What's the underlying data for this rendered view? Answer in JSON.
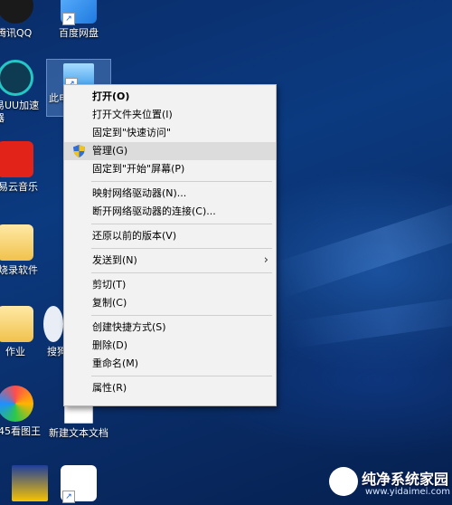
{
  "desktop": {
    "icons": [
      {
        "label": "腾讯QQ",
        "icon": "qq-icon"
      },
      {
        "label": "百度网盘",
        "icon": "baidu-netdisk-icon"
      },
      {
        "label": "易UU加速\n器",
        "icon": "uu-accelerator-icon"
      },
      {
        "label": "此电",
        "icon": "this-pc-icon"
      },
      {
        "label": "易云音乐",
        "icon": "netease-music-icon"
      },
      {
        "label": "烧录软件",
        "icon": "burn-software-folder-icon"
      },
      {
        "label": "作业",
        "icon": "homework-folder-icon"
      },
      {
        "label": "搜狗",
        "icon": "sogou-icon"
      },
      {
        "label": "45看图王",
        "icon": "image-viewer-icon"
      },
      {
        "label": "新建文本文档",
        "icon": "text-document-icon"
      }
    ]
  },
  "context_menu": {
    "items": [
      {
        "label": "打开(O)",
        "bold": true
      },
      {
        "label": "打开文件夹位置(I)"
      },
      {
        "label": "固定到\"快速访问\""
      },
      {
        "label": "管理(G)",
        "icon": "uac-shield-icon",
        "highlight": true
      },
      {
        "label": "固定到\"开始\"屏幕(P)"
      },
      {
        "sep": true
      },
      {
        "label": "映射网络驱动器(N)..."
      },
      {
        "label": "断开网络驱动器的连接(C)..."
      },
      {
        "sep": true
      },
      {
        "label": "还原以前的版本(V)"
      },
      {
        "sep": true
      },
      {
        "label": "发送到(N)",
        "submenu": true
      },
      {
        "sep": true
      },
      {
        "label": "剪切(T)"
      },
      {
        "label": "复制(C)"
      },
      {
        "sep": true
      },
      {
        "label": "创建快捷方式(S)"
      },
      {
        "label": "删除(D)"
      },
      {
        "label": "重命名(M)"
      },
      {
        "sep": true
      },
      {
        "label": "属性(R)"
      }
    ]
  },
  "watermark": {
    "title": "纯净系统家园",
    "url": "www.yidaimei.com"
  }
}
